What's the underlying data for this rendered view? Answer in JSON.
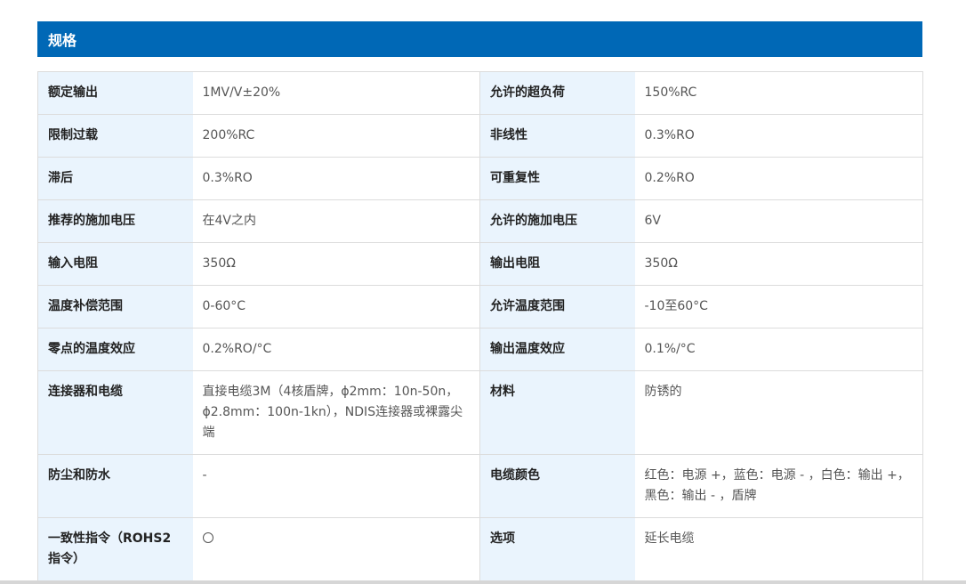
{
  "section": {
    "title": "规格"
  },
  "rows": [
    {
      "left": {
        "label": "额定输出",
        "value": "1MV/V±20%"
      },
      "right": {
        "label": "允许的超负荷",
        "value": "150%RC"
      }
    },
    {
      "left": {
        "label": "限制过载",
        "value": "200%RC"
      },
      "right": {
        "label": "非线性",
        "value": "0.3%RO"
      }
    },
    {
      "left": {
        "label": "滞后",
        "value": "0.3%RO"
      },
      "right": {
        "label": "可重复性",
        "value": "0.2%RO"
      }
    },
    {
      "left": {
        "label": "推荐的施加电压",
        "value": "在4V之内"
      },
      "right": {
        "label": "允许的施加电压",
        "value": "6V"
      }
    },
    {
      "left": {
        "label": "输入电阻",
        "value": "350Ω"
      },
      "right": {
        "label": "输出电阻",
        "value": "350Ω"
      }
    },
    {
      "left": {
        "label": "温度补偿范围",
        "value": "0-60°C"
      },
      "right": {
        "label": "允许温度范围",
        "value": "-10至60°C"
      }
    },
    {
      "left": {
        "label": "零点的温度效应",
        "value": "0.2%RO/°C"
      },
      "right": {
        "label": "输出温度效应",
        "value": "0.1%/°C"
      }
    },
    {
      "left": {
        "label": "连接器和电缆",
        "value": "直接电缆3M（4核盾牌，ϕ2mm：10n-50n，ϕ2.8mm：100n-1kn），NDIS连接器或裸露尖端"
      },
      "right": {
        "label": "材料",
        "value": "防锈的"
      }
    },
    {
      "left": {
        "label": "防尘和防水",
        "value": "-"
      },
      "right": {
        "label": "电缆颜色",
        "value": "红色：电源 +，蓝色：电源 - ，白色：输出 +，黑色：输出 - ，盾牌"
      }
    },
    {
      "left": {
        "label": "一致性指令（ROHS2指令）",
        "value_icon": "circle-icon"
      },
      "right": {
        "label": "选项",
        "value": "延长电缆"
      }
    }
  ],
  "colors": {
    "header_bg": "#0068b6",
    "label_bg": "#eaf4fd",
    "border": "#dcdcdc"
  }
}
